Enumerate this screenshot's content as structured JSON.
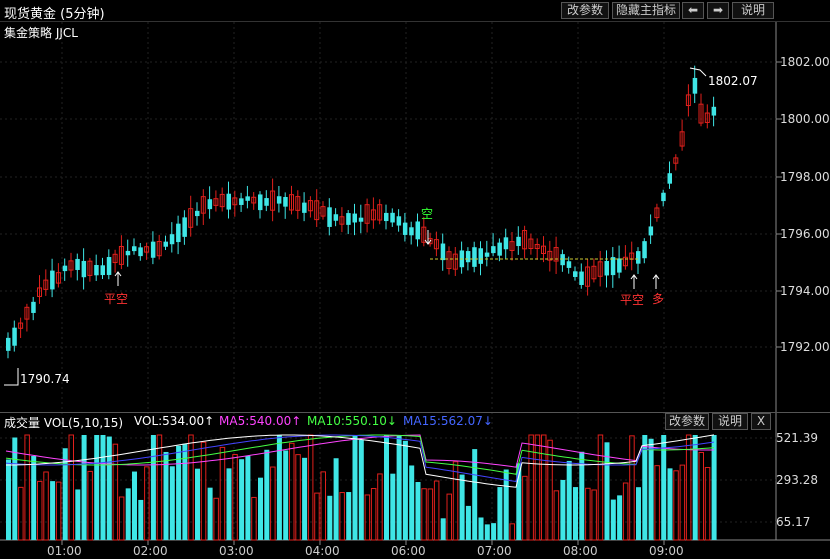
{
  "header": {
    "title": "现货黄金 (5分钟)",
    "btn_params": "改参数",
    "btn_hide_indicator": "隐藏主指标",
    "btn_left": "⬅",
    "btn_right": "➡",
    "btn_help": "说明"
  },
  "strategy": "集金策略 JJCL",
  "price_axis": [
    "1802.00",
    "1800.00",
    "1798.00",
    "1796.00",
    "1794.00",
    "1792.00"
  ],
  "annotations": {
    "high": "1802.07",
    "low": "1790.74"
  },
  "signals": [
    {
      "text": "平空",
      "color": "#ff3333"
    },
    {
      "text": "空",
      "color": "#33ff33"
    },
    {
      "text": "平空",
      "color": "#ff3333"
    },
    {
      "text": "多",
      "color": "#ff3333"
    }
  ],
  "volume_panel": {
    "label": "成交量 VOL(5,10,15)",
    "vol": "VOL:534.00↑",
    "ma5": "MA5:540.00↑",
    "ma10": "MA10:550.10↓",
    "ma15": "MA15:562.07↓",
    "btn_params": "改参数",
    "btn_help": "说明",
    "btn_close": "X",
    "axis": [
      "521.39",
      "293.28",
      "65.17"
    ]
  },
  "time_axis": [
    "01:00",
    "02:00",
    "03:00",
    "04:00",
    "06:00",
    "07:00",
    "08:00",
    "09:00"
  ],
  "colors": {
    "up": "#e0201c",
    "down": "#3fe6e6",
    "ma5": "#ff44ff",
    "ma10": "#44ff44",
    "ma15": "#4444ff",
    "ma_white": "#ffffff",
    "dashed_level": "#cccc33"
  }
}
